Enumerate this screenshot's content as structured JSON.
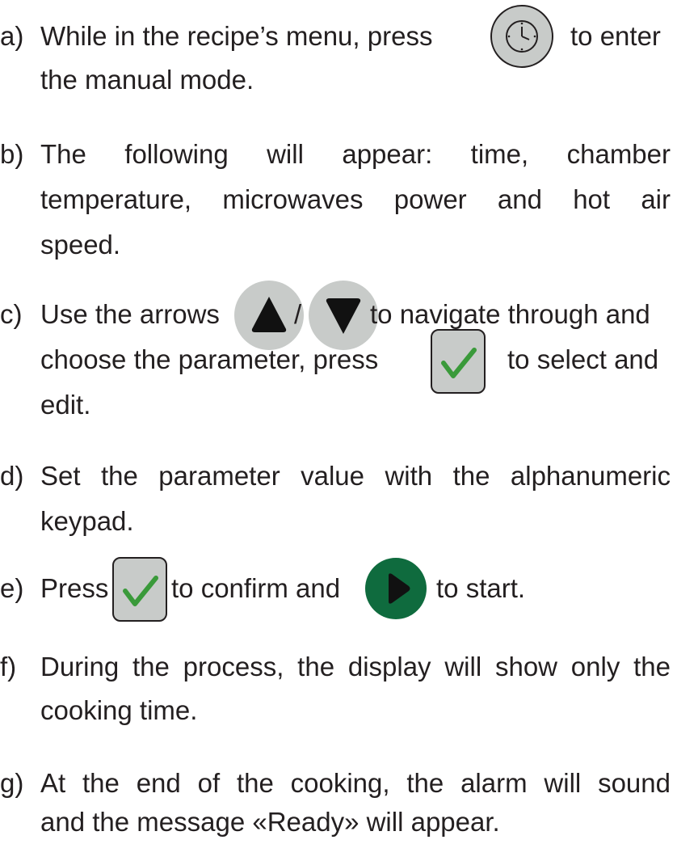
{
  "steps": {
    "a": {
      "label": "a)",
      "line1_before": "While in the recipe’s menu, press",
      "line1_after": "to enter",
      "line2": "the manual mode.",
      "icon": "clock-icon"
    },
    "b": {
      "label": "b)",
      "line1": "The following will appear: time, chamber",
      "line2": "temperature, microwaves power and hot air",
      "line3": "speed."
    },
    "c": {
      "label": "c)",
      "line1_before": "Use the arrows",
      "slash": "/",
      "line1_after": "to navigate through and",
      "line2_before": "choose the parameter, press",
      "line2_after": "to select and",
      "line3": "edit.",
      "icons": [
        "arrow-up-icon",
        "arrow-down-icon",
        "check-icon"
      ]
    },
    "d": {
      "label": "d)",
      "line1": "Set the parameter value with the alphanumeric",
      "line2": "keypad."
    },
    "e": {
      "label": "e)",
      "before": "Press",
      "middle": "to confirm and",
      "after": "to start.",
      "icons": [
        "check-icon",
        "play-icon"
      ]
    },
    "f": {
      "label": "f)",
      "line1": "During the process, the display will show only the",
      "line2": "cooking time."
    },
    "g": {
      "label": "g)",
      "line1": "At the end of the cooking, the alarm will sound",
      "line2": "and the message «Ready» will appear."
    }
  },
  "colors": {
    "text": "#231f20",
    "button_gray": "#c8cbc9",
    "check_green": "#3a9a3a",
    "play_green": "#0f6b3e",
    "arrow_black": "#111111"
  }
}
